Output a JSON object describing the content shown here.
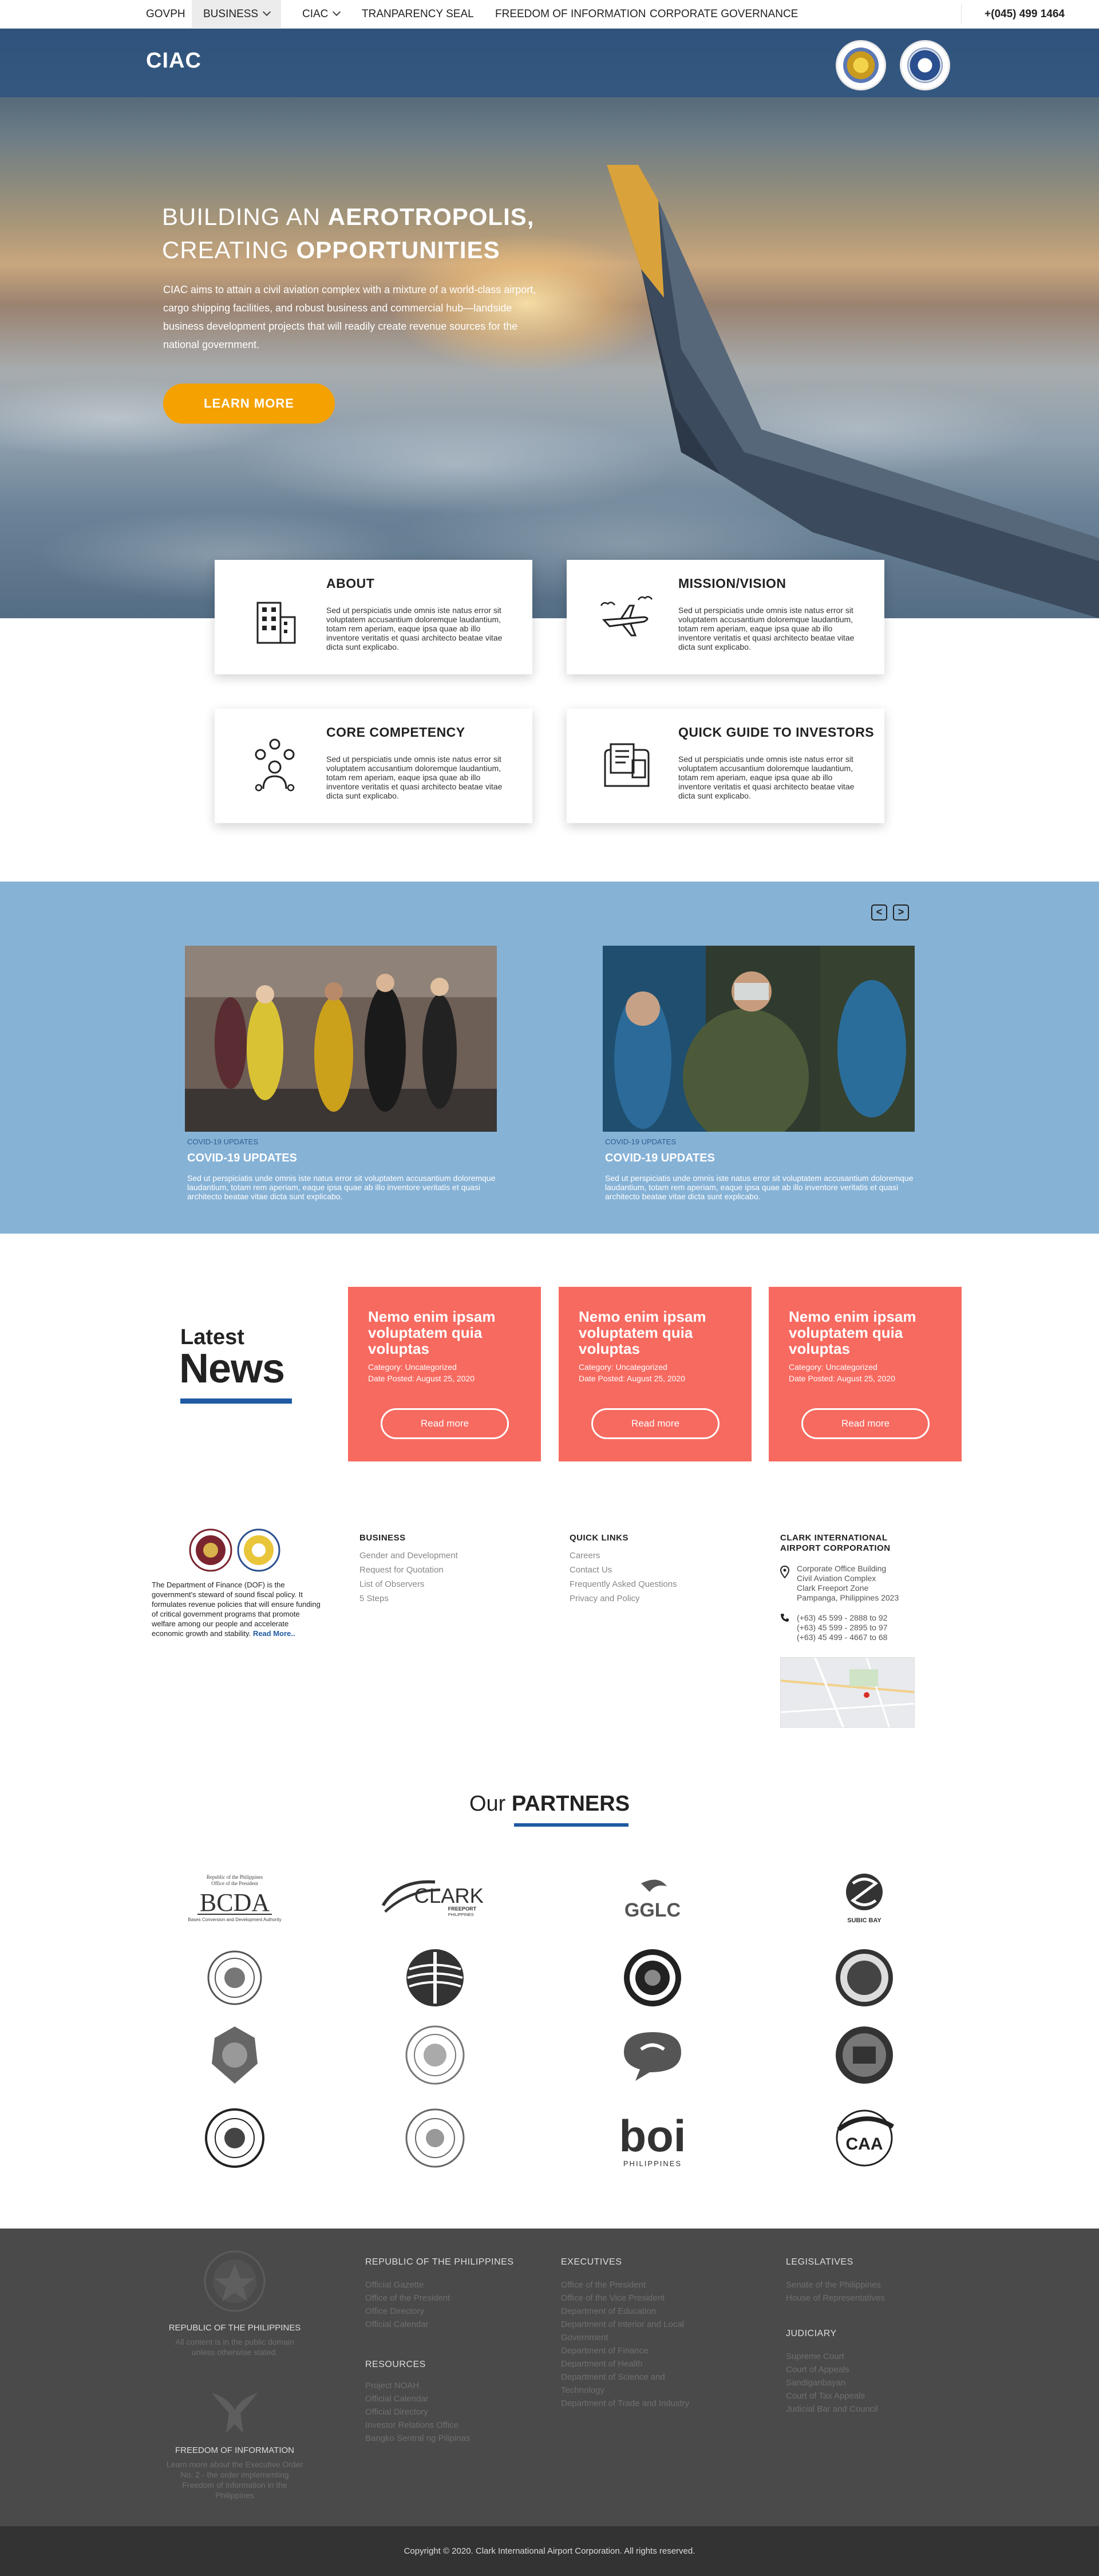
{
  "topnav": {
    "items": [
      "GOVPH",
      "BUSINESS",
      "CIAC",
      "TRANPARENCY SEAL",
      "FREEDOM OF INFORMATION",
      "CORPORATE GOVERNANCE"
    ],
    "phone": "+(045) 499 1464"
  },
  "header": {
    "brand": "CIAC"
  },
  "hero": {
    "title_line1_plain": "BUILDING AN ",
    "title_line1_bold": "AEROTROPOLIS,",
    "title_line2_plain": "CREATING ",
    "title_line2_bold": "OPPORTUNITIES",
    "text": "CIAC aims to attain a civil aviation complex with a mixture of a world-class airport, cargo shipping facilities, and robust business and commercial hub—landside business development projects that will readily create revenue sources for the national government.",
    "button": "LEARN MORE"
  },
  "info_cards": [
    {
      "title": "ABOUT",
      "icon": "building-icon",
      "text": "Sed ut perspiciatis unde omnis iste natus error sit voluptatem accusantium doloremque laudantium, totam rem aperiam, eaque ipsa quae ab illo inventore veritatis et quasi architecto beatae vitae dicta sunt explicabo."
    },
    {
      "title": "MISSION/VISION",
      "icon": "airplane-icon",
      "text": "Sed ut perspiciatis unde omnis iste natus error sit voluptatem accusantium doloremque laudantium, totam rem aperiam, eaque ipsa quae ab illo inventore veritatis et quasi architecto beatae vitae dicta sunt explicabo."
    },
    {
      "title": "CORE COMPETENCY",
      "icon": "network-person-icon",
      "text": "Sed ut perspiciatis unde omnis iste natus error sit voluptatem accusantium doloremque laudantium, totam rem aperiam, eaque ipsa quae ab illo inventore veritatis et quasi architecto beatae vitae dicta sunt explicabo."
    },
    {
      "title": "QUICK GUIDE TO INVESTORS",
      "icon": "guide-document-icon",
      "text": "Sed ut perspiciatis unde omnis iste natus error sit voluptatem accusantium doloremque laudantium, totam rem aperiam, eaque ipsa quae ab illo inventore veritatis et quasi architecto beatae vitae dicta sunt explicabo."
    }
  ],
  "slider": {
    "prev": "<",
    "next": ">",
    "slides": [
      {
        "category": "COVID-19 UPDATES",
        "title": "COVID-19 UPDATES",
        "text": "Sed ut perspiciatis unde omnis iste natus error sit voluptatem accusantium doloremque laudantium, totam rem aperiam, eaque ipsa quae ab illo inventore veritatis et quasi architecto beatae vitae dicta sunt explicabo."
      },
      {
        "category": "COVID-19 UPDATES",
        "title": "COVID-19 UPDATES",
        "text": "Sed ut perspiciatis unde omnis iste natus error sit voluptatem accusantium doloremque laudantium, totam rem aperiam, eaque ipsa quae ab illo inventore veritatis et quasi architecto beatae vitae dicta sunt explicabo."
      }
    ]
  },
  "news": {
    "latest": "Latest",
    "word": "News",
    "cards": [
      {
        "title": "Nemo enim ipsam voluptatem quia voluptas",
        "category": "Category: Uncategorized",
        "date": "Date Posted: August 25, 2020",
        "button": "Read more"
      },
      {
        "title": "Nemo enim ipsam voluptatem quia voluptas",
        "category": "Category: Uncategorized",
        "date": "Date Posted: August 25, 2020",
        "button": "Read more"
      },
      {
        "title": "Nemo enim ipsam voluptatem quia voluptas",
        "category": "Category: Uncategorized",
        "date": "Date Posted: August 25, 2020",
        "button": "Read more"
      }
    ]
  },
  "dof": {
    "text": "The Department of Finance (DOF) is the government's steward of sound fiscal policy. It formulates revenue policies that will ensure funding of critical government programs that promote welfare among our people and accelerate economic growth and stability.",
    "link": "Read More.."
  },
  "business": {
    "heading": "BUSINESS",
    "items": [
      "Gender and Development",
      "Request for Quotation",
      "List of Observers",
      "5 Steps"
    ]
  },
  "quicklinks": {
    "heading": "QUICK LINKS",
    "items": [
      "Careers",
      "Contact Us",
      "Frequently Asked Questions",
      "Privacy and Policy"
    ]
  },
  "contact": {
    "heading_line1": "CLARK INTERNATIONAL",
    "heading_line2": "AIRPORT CORPORATION",
    "address": [
      "Corporate Office Building",
      "Civil Aviation Complex",
      "Clark Freeport Zone",
      "Pampanga, Philippines 2023"
    ],
    "phones": [
      "(+63) 45 599 - 2888 to 92",
      "(+63) 45 599 - 2895 to 97",
      "(+63) 45 499 - 4667 to 68"
    ]
  },
  "partners": {
    "title_plain": "Our ",
    "title_bold": "PARTNERS",
    "logo_texts": {
      "bcda_top": "Republic of the Philippines",
      "bcda_sub": "Office of the President",
      "bcda": "BCDA",
      "bcda_foot": "Bases Conversion and Development Authority",
      "clark": "CLARK",
      "clark_sub": "FREEPORT",
      "clark_country": "PHILIPPINES",
      "gglc": "GGLC",
      "subic": "SUBIC BAY",
      "boi": "boi",
      "boi_sub": "PHILIPPINES",
      "caa": "CAA"
    }
  },
  "footer": {
    "rp_title": "REPUBLIC OF THE PHILIPPINES",
    "rp_text": "All content is in the public domain unless otherwise stated.",
    "foi_title": "FREEDOM OF INFORMATION",
    "foi_text": "Learn more about the Executive Order No. 2 - the order implementing Freedom of Information in the Philippines",
    "rp_heading": "REPUBLIC OF THE PHILIPPINES",
    "rp_links": [
      "Official Gazette",
      "Office of the President",
      "Office Directory",
      "Official Calendar"
    ],
    "resources_heading": "RESOURCES",
    "resources_links": [
      "Project NOAH",
      "Official Calendar",
      "Official Directory",
      "Investor Relations Office",
      "Bangko Sentral ng Pilipinas"
    ],
    "exec_heading": "EXECUTIVES",
    "exec_links": [
      "Office of the President",
      "Office of the Vice President",
      "Department of Education",
      "Department of Interior and Local",
      "Government",
      "Department of Finance",
      "Department of Health",
      "Department of Science and",
      "Technology",
      "Department of Trade and Industry"
    ],
    "leg_heading": "LEGISLATIVES",
    "leg_links": [
      "Senate of the Philippines",
      "House of Representatives"
    ],
    "jud_heading": "JUDICIARY",
    "jud_links": [
      "Supreme Court",
      "Court of Appeals",
      "Sandiganbayan",
      "Court of Tax Appeals",
      "Judicial Bar and Council"
    ]
  },
  "copyright": "Copyright © 2020. Clark International Airport Corporation. All rights reserved."
}
